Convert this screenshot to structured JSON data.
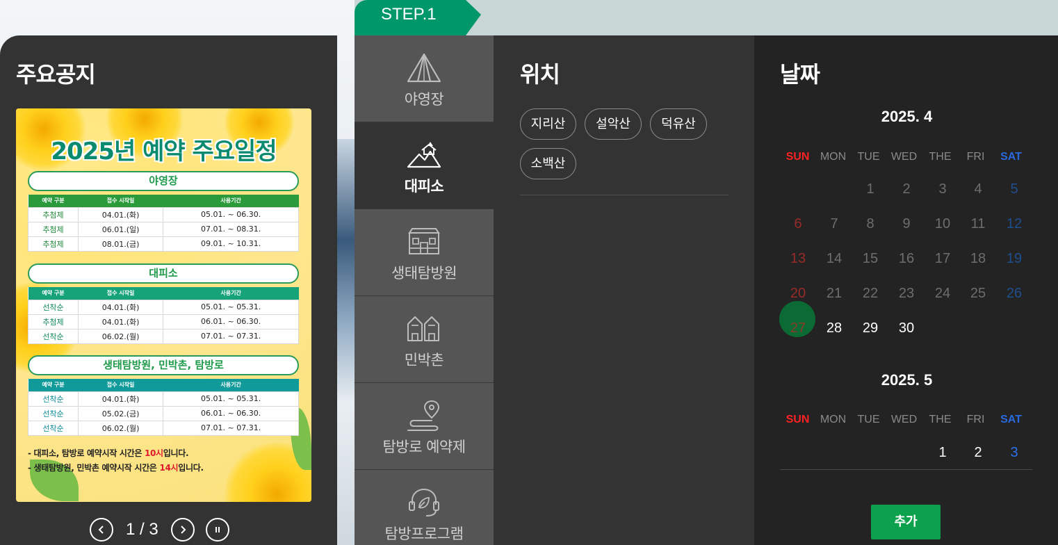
{
  "notice": {
    "title": "주요공지",
    "poster": {
      "heading": "2025년 예약 주요일정",
      "sections": [
        {
          "name": "야영장",
          "headers": [
            "예약 구분",
            "접수 시작일",
            "사용기간"
          ],
          "rows": [
            [
              "추첨제",
              "04.01.(화)",
              "05.01. ~ 06.30."
            ],
            [
              "추첨제",
              "06.01.(일)",
              "07.01. ~ 08.31."
            ],
            [
              "추첨제",
              "08.01.(금)",
              "09.01. ~ 10.31."
            ]
          ]
        },
        {
          "name": "대피소",
          "headers": [
            "예약 구분",
            "접수 시작일",
            "사용기간"
          ],
          "rows": [
            [
              "선착순",
              "04.01.(화)",
              "05.01. ~ 05.31."
            ],
            [
              "추첨제",
              "04.01.(화)",
              "06.01. ~ 06.30."
            ],
            [
              "선착순",
              "06.02.(월)",
              "07.01. ~ 07.31."
            ]
          ]
        },
        {
          "name": "생태탐방원, 민박촌, 탐방로",
          "headers": [
            "예약 구분",
            "접수 시작일",
            "사용기간"
          ],
          "rows": [
            [
              "선착순",
              "04.01.(화)",
              "05.01. ~ 05.31."
            ],
            [
              "선착순",
              "05.02.(금)",
              "06.01. ~ 06.30."
            ],
            [
              "선착순",
              "06.02.(월)",
              "07.01. ~ 07.31."
            ]
          ]
        }
      ],
      "note1_pre": "- 대피소, 탐방로 예약시작 시간은 ",
      "note1_hl": "10시",
      "note1_post": "입니다.",
      "note2_pre": "- 생태탐방원, 민박촌 예약시작 시간은 ",
      "note2_hl": "14시",
      "note2_post": "입니다."
    },
    "pager": {
      "current": "1",
      "sep": "/",
      "total": "3"
    }
  },
  "step": {
    "label": "STEP.1"
  },
  "categories": [
    {
      "label": "야영장",
      "icon": "tent-icon"
    },
    {
      "label": "대피소",
      "icon": "shelter-icon",
      "active": true
    },
    {
      "label": "생태탐방원",
      "icon": "eco-center-icon"
    },
    {
      "label": "민박촌",
      "icon": "houses-icon"
    },
    {
      "label": "탐방로 예약제",
      "icon": "trail-pin-icon"
    },
    {
      "label": "탐방프로그램",
      "icon": "headset-leaf-icon"
    }
  ],
  "location": {
    "title": "위치",
    "options": [
      "지리산",
      "설악산",
      "덕유산",
      "소백산"
    ]
  },
  "date": {
    "title": "날짜",
    "weekdays": [
      "SUN",
      "MON",
      "TUE",
      "WED",
      "THE",
      "FRI",
      "SAT"
    ],
    "months": [
      {
        "title": "2025. 4",
        "weeks": [
          [
            "",
            "",
            "1",
            "2",
            "3",
            "4",
            "5"
          ],
          [
            "6",
            "7",
            "8",
            "9",
            "10",
            "11",
            "12"
          ],
          [
            "13",
            "14",
            "15",
            "16",
            "17",
            "18",
            "19"
          ],
          [
            "20",
            "21",
            "22",
            "23",
            "24",
            "25",
            "26"
          ],
          [
            "27",
            "28",
            "29",
            "30",
            "",
            "",
            ""
          ]
        ]
      },
      {
        "title": "2025. 5",
        "weeks": [
          [
            "",
            "",
            "",
            "",
            "1",
            "2",
            "3"
          ]
        ]
      }
    ],
    "add_label": "추가",
    "colors": {
      "selected": "#0c6b34",
      "accent": "#0ca14c",
      "sunday": "#ff2222",
      "saturday": "#2a6ae0"
    }
  }
}
